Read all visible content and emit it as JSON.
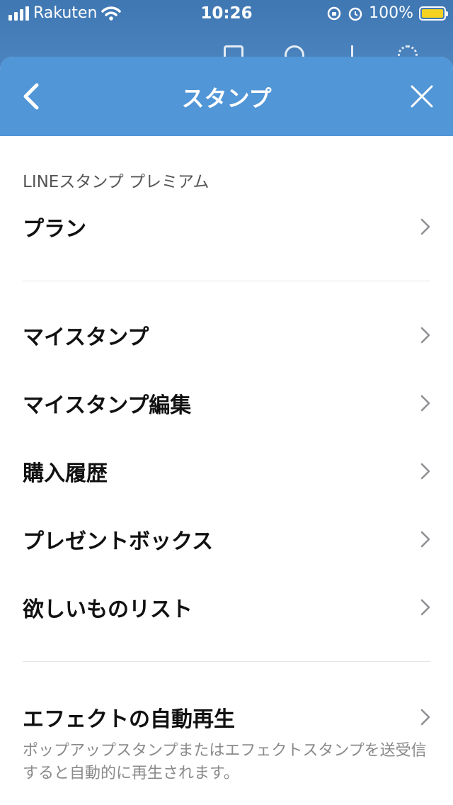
{
  "status_bar": {
    "carrier": "Rakuten",
    "time": "10:26",
    "battery": "100%",
    "battery_level": 1.0
  },
  "nav": {
    "title": "スタンプ",
    "back_icon": "chevron-left-icon",
    "close_icon": "close-icon"
  },
  "sections": {
    "premium_header": "LINEスタンプ プレミアム",
    "plan_label": "プラン",
    "my_stickers_label": "マイスタンプ",
    "edit_my_stickers_label": "マイスタンプ編集",
    "purchase_history_label": "購入履歴",
    "present_box_label": "プレゼントボックス",
    "wishlist_label": "欲しいものリスト",
    "auto_play_label": "エフェクトの自動再生",
    "auto_play_desc": "ポップアップスタンプまたはエフェクトスタンプを送受信すると自動的に再生されます。"
  },
  "colors": {
    "nav_bg": "#5196d6",
    "status_bg": "#3f77b3",
    "battery_fill": "#f5d21f"
  }
}
